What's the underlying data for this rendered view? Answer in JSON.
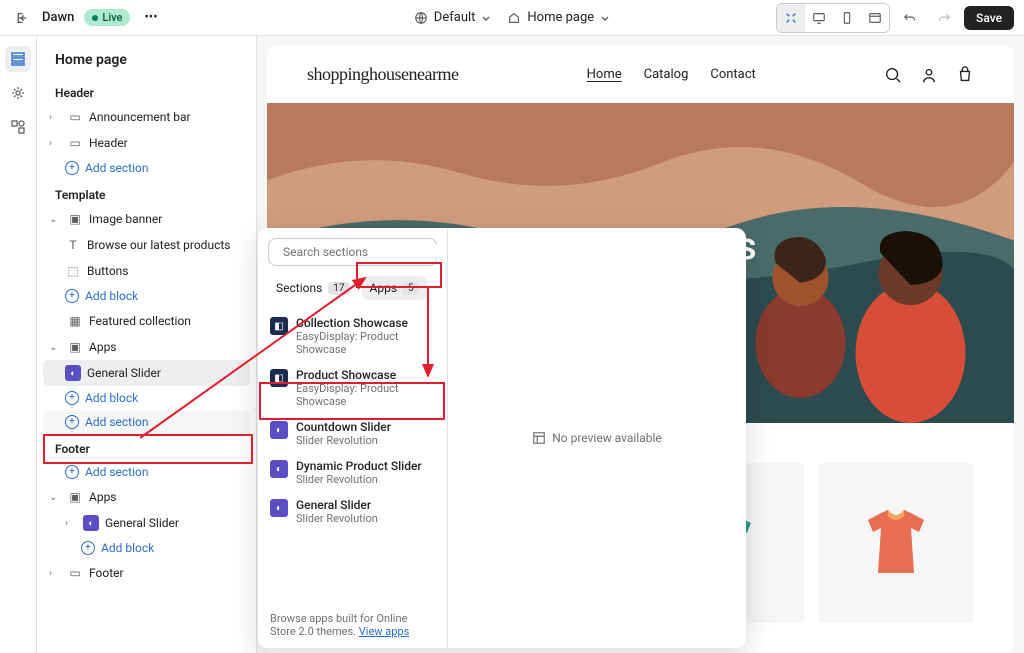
{
  "topbar": {
    "theme": "Dawn",
    "status": "Live",
    "locale": "Default",
    "page": "Home page",
    "save": "Save"
  },
  "sidebar": {
    "page_title": "Home page",
    "header": {
      "title": "Header",
      "items": [
        "Announcement bar",
        "Header"
      ],
      "add": "Add section"
    },
    "template": {
      "title": "Template",
      "banner": {
        "name": "Image banner",
        "children": [
          "Browse our latest products",
          "Buttons"
        ],
        "add": "Add block"
      },
      "featured": "Featured collection",
      "apps": {
        "name": "Apps",
        "children": [
          "General Slider"
        ],
        "add": "Add block"
      },
      "add": "Add section"
    },
    "footer_group": {
      "title": "Footer",
      "add": "Add section",
      "apps": {
        "name": "Apps",
        "children": [
          "General Slider"
        ],
        "add": "Add block"
      },
      "footer": "Footer"
    }
  },
  "store": {
    "brand": "shoppinghousenearme",
    "nav": [
      "Home",
      "Catalog",
      "Contact"
    ],
    "hero_fragment": "roducts"
  },
  "popup": {
    "search_placeholder": "Search sections",
    "tabs": {
      "sections": {
        "label": "Sections",
        "count": "17"
      },
      "apps": {
        "label": "Apps",
        "count": "5"
      }
    },
    "apps": [
      {
        "name": "Collection Showcase",
        "pub": "EasyDisplay: Product Showcase",
        "color": "ai-blue"
      },
      {
        "name": "Product Showcase",
        "pub": "EasyDisplay: Product Showcase",
        "color": "ai-blue"
      },
      {
        "name": "Countdown Slider",
        "pub": "Slider Revolution",
        "color": "ai-purple"
      },
      {
        "name": "Dynamic Product Slider",
        "pub": "Slider Revolution",
        "color": "ai-purple"
      },
      {
        "name": "General Slider",
        "pub": "Slider Revolution",
        "color": "ai-purple"
      }
    ],
    "footer_text": "Browse apps built for Online Store 2.0 themes. ",
    "footer_link": "View apps",
    "no_preview": "No preview available"
  }
}
